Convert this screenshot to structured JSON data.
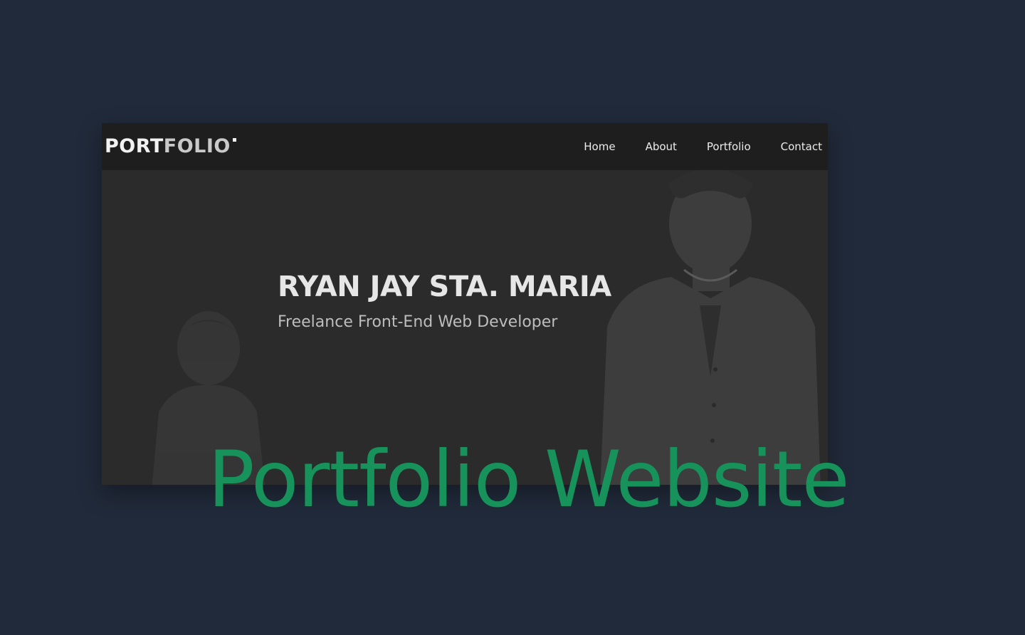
{
  "preview": {
    "logo": {
      "part_a": "PORT",
      "part_b": "FOLIO"
    },
    "nav": [
      {
        "label": "Home"
      },
      {
        "label": "About"
      },
      {
        "label": "Portfolio"
      },
      {
        "label": "Contact"
      }
    ],
    "hero": {
      "name": "RYAN JAY STA. MARIA",
      "role": "Freelance Front-End Web Developer"
    }
  },
  "caption": "Portfolio Website",
  "colors": {
    "page_background": "#212a3a",
    "navbar_background": "#1e1e1e",
    "hero_background": "#2b2b2b",
    "caption_green": "#16925a"
  }
}
